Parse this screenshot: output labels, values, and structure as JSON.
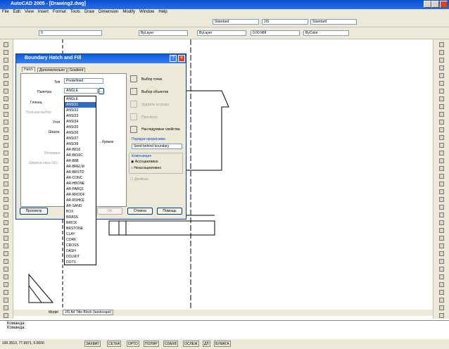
{
  "app": {
    "title": "AutoCAD 2005 - [Drawing2.dwg]"
  },
  "menu": [
    "File",
    "Edit",
    "View",
    "Insert",
    "Format",
    "Tools",
    "Draw",
    "Dimension",
    "Modify",
    "Window",
    "Help"
  ],
  "toolbar": {
    "style1": "Standard",
    "style2": "JIS",
    "style3": "Standard",
    "layer": "0",
    "color": "ByLayer",
    "linetype": "ByLayer",
    "lineweight": "0.00 MM",
    "plotstyle": "ByColor"
  },
  "dialog": {
    "title": "Boundary Hatch and Fill",
    "tabs": [
      "Hatch",
      "Дополнительно",
      "Gradient"
    ],
    "type_label": "Тип",
    "type_value": "Predefined",
    "pattern_label": "Палитра",
    "pattern_value": "ANGLE",
    "swatch_label": "Глянец",
    "custom_label": "Пользов.выбор",
    "angle_label": "Угол",
    "scale_label": "Шкала",
    "relative_label": "...бумаги",
    "spacing_label": "Интервал",
    "iso_label": "Ширина пера ISO",
    "pick_points": "Выбор точек",
    "select_objects": "Выбор объектов",
    "remove_islands": "Удалить острова",
    "view_selections": "Просмотр",
    "inherit": "Наследуемые свойства",
    "draw_order_label": "Порядок прорисовки",
    "draw_order_value": "Send behind boundary",
    "composition_label": "Композиция",
    "associative": "Ассоциативно",
    "nonassociative": "Неассоциативно",
    "double": "Двойная",
    "preview_btn": "Просмотр",
    "ok_btn": "OK",
    "cancel_btn": "Отмена",
    "help_btn": "Помощь"
  },
  "pattern_list": [
    "ANGLE",
    "ANSI31",
    "ANSI32",
    "ANSI33",
    "ANSI34",
    "ANSI35",
    "ANSI36",
    "ANSI37",
    "ANSI38",
    "AR-B816",
    "AR-B816C",
    "AR-B88",
    "AR-BRELM",
    "AR-BRSTD",
    "AR-CONC",
    "AR-HBONE",
    "AR-PARQ1",
    "AR-RROOF",
    "AR-RSHKE",
    "AR-SAND",
    "BOX",
    "BRASS",
    "BRICK",
    "BRSTONE",
    "CLAY",
    "CORK",
    "CROSS",
    "DASH",
    "DOLMIT",
    "DOTS"
  ],
  "selected_pattern": "ANSI31",
  "tabs_bottom": {
    "model": "Model",
    "layout": "JIS A4 Title Block (landscape)"
  },
  "command": {
    "line1": "Команда:",
    "line2": "Команда:"
  },
  "status": {
    "coords": "190.3510, 77.6971, 0.0000",
    "items": [
      "ЗАХВАТ",
      "СЕТКА",
      "ОРТО",
      "ПОЛЯР",
      "ОЗАХВ",
      "ОСЛЕЖ",
      "ДЛ",
      "БУМАГА"
    ]
  }
}
